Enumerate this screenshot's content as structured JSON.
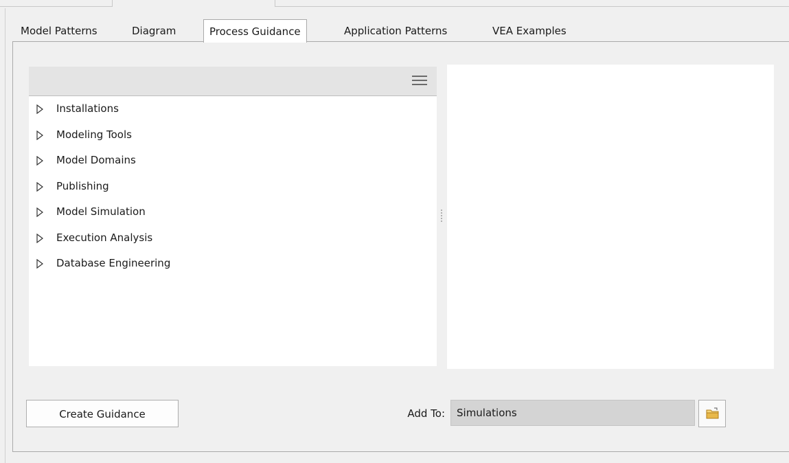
{
  "tabs": [
    {
      "label": "Model Patterns",
      "active": false
    },
    {
      "label": "Diagram",
      "active": false
    },
    {
      "label": "Process Guidance",
      "active": true
    },
    {
      "label": "Application Patterns",
      "active": false
    },
    {
      "label": "VEA Examples",
      "active": false
    }
  ],
  "tree": {
    "menu_icon": "hamburger-menu-icon",
    "expander_icon": "triangle-right-outline-icon",
    "items": [
      {
        "label": "Installations"
      },
      {
        "label": "Modeling Tools"
      },
      {
        "label": "Model Domains"
      },
      {
        "label": "Publishing"
      },
      {
        "label": "Model Simulation"
      },
      {
        "label": "Execution Analysis"
      },
      {
        "label": "Database Engineering"
      }
    ]
  },
  "footer": {
    "create_button_label": "Create Guidance",
    "add_to_label": "Add To:",
    "add_to_value": "Simulations",
    "browse_icon": "folder-open-icon"
  },
  "colors": {
    "background": "#f0f0f0",
    "pane": "#ffffff",
    "header": "#e4e4e4",
    "field_readonly": "#d4d4d4",
    "folder": "#e8b84a"
  }
}
